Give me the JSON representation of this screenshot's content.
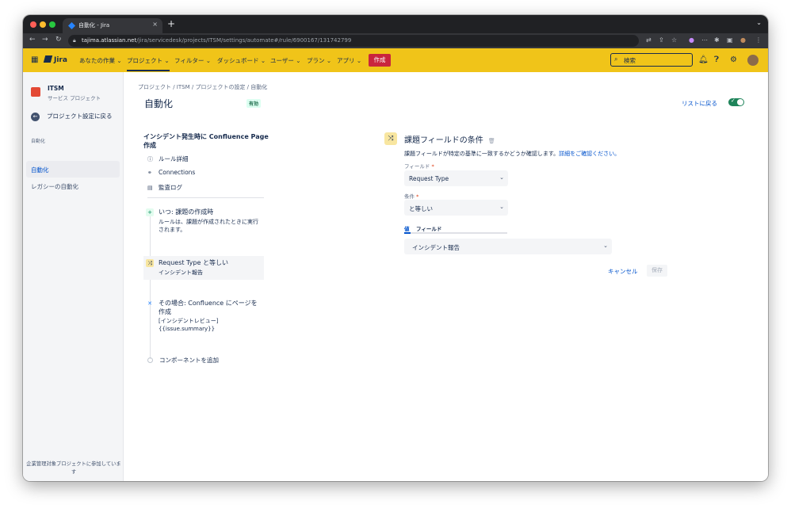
{
  "browser": {
    "tab_title": "自動化 - Jira",
    "tab_close": "×",
    "new_tab": "+",
    "tab_menu": "⌄",
    "back": "←",
    "forward": "→",
    "reload": "↻",
    "url_host": "tajima.atlassian.net",
    "url_path": "/jira/servicedesk/projects/ITSM/settings/automate#/rule/6900167/131742799"
  },
  "topnav": {
    "logo": "Jira",
    "menus": [
      "あなたの作業 ⌄",
      "プロジェクト ⌄",
      "フィルター ⌄",
      "ダッシュボード ⌄",
      "ユーザー ⌄",
      "プラン ⌄",
      "アプリ ⌄"
    ],
    "create": "作成",
    "search_placeholder": "検索"
  },
  "sidebar": {
    "project_name": "ITSM",
    "project_type": "サービス プロジェクト",
    "back_label": "プロジェクト設定に戻る",
    "section_heading": "自動化",
    "items": [
      {
        "label": "自動化",
        "selected": true
      },
      {
        "label": "レガシーの自動化",
        "selected": false
      }
    ],
    "footer": "企業管理対象プロジェクトに参加しています"
  },
  "main": {
    "breadcrumb": "プロジェクト  /  ITSM  /  プロジェクトの設定  /  自動化",
    "title": "自動化",
    "status_badge": "有効",
    "back_to_list": "リストに戻る",
    "toggle_check": "✓",
    "rule_name": "インシデント発生時に Confluence Page 作成",
    "rule_links": [
      "ルール詳細",
      "Connections",
      "監査ログ"
    ],
    "steps": [
      {
        "icon": "+",
        "title": "いつ: 課題の作成時",
        "desc": "ルールは、課題が作成されたときに実行されます。"
      },
      {
        "icon": "⤨",
        "title": "Request Type と等しい",
        "desc": "インシデント報告"
      },
      {
        "icon": "✕",
        "title": "その場合: Confluence にページを作成",
        "desc": "[インシデントレビュー]\n{{issue.summary}}"
      }
    ],
    "add_component": "コンポーネントを追加"
  },
  "panel": {
    "icon": "⤨",
    "title": "課題フィールドの条件",
    "delete_icon": "🗑",
    "description": "課題フィールドが特定の基準に一致するかどうか確認します。",
    "description_link": "詳細をご確認ください。",
    "field_label": "フィールド",
    "field_value": "Request Type",
    "condition_label": "条件",
    "condition_value": "と等しい",
    "required_mark": "*",
    "tab_value": "値",
    "tab_field": "フィールド",
    "value_select": "インシデント報告",
    "cancel": "キャンセル",
    "save": "保存"
  }
}
